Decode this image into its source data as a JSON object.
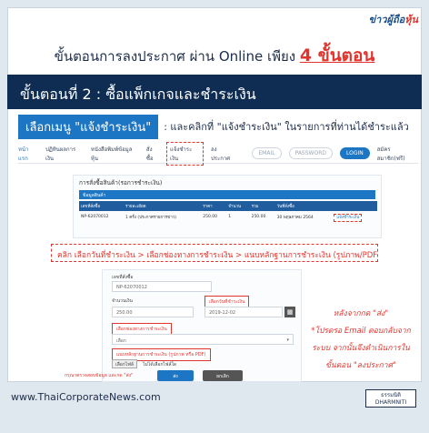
{
  "brand": {
    "name_part1": "ข่าวผู้ถือ",
    "name_part2": "หุ้น"
  },
  "headline": {
    "text": "ขั้นตอนการลงประกาศ ผ่าน Online เพียง ",
    "highlight": "4 ขั้นตอน"
  },
  "step": {
    "title": "ขั้นตอนที่ 2 : ซื้อแพ็กเกจและชำระเงิน"
  },
  "instruction": {
    "chip": "เลือกเมนู \"แจ้งชำระเงิน\"",
    "text": ": และคลิกที่ \"แจ้งชำระเงิน\" ในรายการที่ท่านได้ชำระแล้ว"
  },
  "nav": {
    "items": [
      "หน้าแรก",
      "ปฏิทินผลการเงิน",
      "หนังสือพิมพ์ข้อมูลหุ้น",
      "สั่งซื้อ",
      "แจ้งชำระเงิน",
      "ลงประกาศ"
    ],
    "email_pill": "EMAIL",
    "password_pill": "PASSWORD",
    "login_pill": "LOGIN",
    "register_link": "สมัครสมาชิก(ฟรี)"
  },
  "orders": {
    "title": "การสั่งซื้อสินค้า(รอการชำระเงิน)",
    "subtitle": "ข้อมูลสินค้า",
    "columns": [
      "เลขที่สั่งซื้อ",
      "รายละเอียด",
      "ราคา",
      "จำนวน",
      "รวม",
      "วันที่สั่งซื้อ",
      ""
    ],
    "rows": [
      [
        "NP-62070012",
        "1 ครั้ง (ประกาศรายการข่าว)",
        "250.00",
        "1",
        "250.00",
        "30 พฤษภาคม 2564",
        "แจ้งชำระเงิน"
      ]
    ]
  },
  "breadcrumb": {
    "text": "คลิก เลือกวันที่ชำระเงิน > เลือกช่องทางการชำระเงิน > แนบหลักฐานการชำระเงิน (รูปภาพ/PDF)"
  },
  "form": {
    "order_no_label": "เลขที่สั่งซื้อ",
    "order_no_value": "NP-62070012",
    "amount_label": "จำนวนเงิน",
    "amount_value": "250.00",
    "date_label_red": "เลือกวันที่ชำระเงิน",
    "date_value": "2019-12-02",
    "channel_label_red": "เลือกช่องทางการชำระเงิน",
    "channel_placeholder": "เลือก",
    "attach_label_red": "แนบหลักฐานการชำระเงิน (รูปภาพ หรือ PDF)",
    "file_button": "เลือกไฟล์",
    "file_status": "ไม่ได้เลือกไฟล์ใด",
    "check_text": "กรุณาตรวจสอบข้อมูล และกด \"ส่ง\"",
    "submit_label": "ส่ง",
    "cancel_label": "ยกเลิก"
  },
  "note": {
    "lines": [
      "หลังจากกด \"ส่ง\"",
      "*โปรดรอ Email ตอบกลับจาก",
      "ระบบ จากนั้นจึงดำเนินการใน",
      "ขั้นตอน \"ลงประกาศ\""
    ]
  },
  "footer": {
    "url": "www.ThaiCorporateNews.com",
    "logo_line1": "ธรรมนิติ",
    "logo_line2": "DHARMNITI"
  },
  "colors": {
    "accent_red": "#e2342d",
    "navy": "#0f2c52",
    "blue": "#1c76c4"
  }
}
